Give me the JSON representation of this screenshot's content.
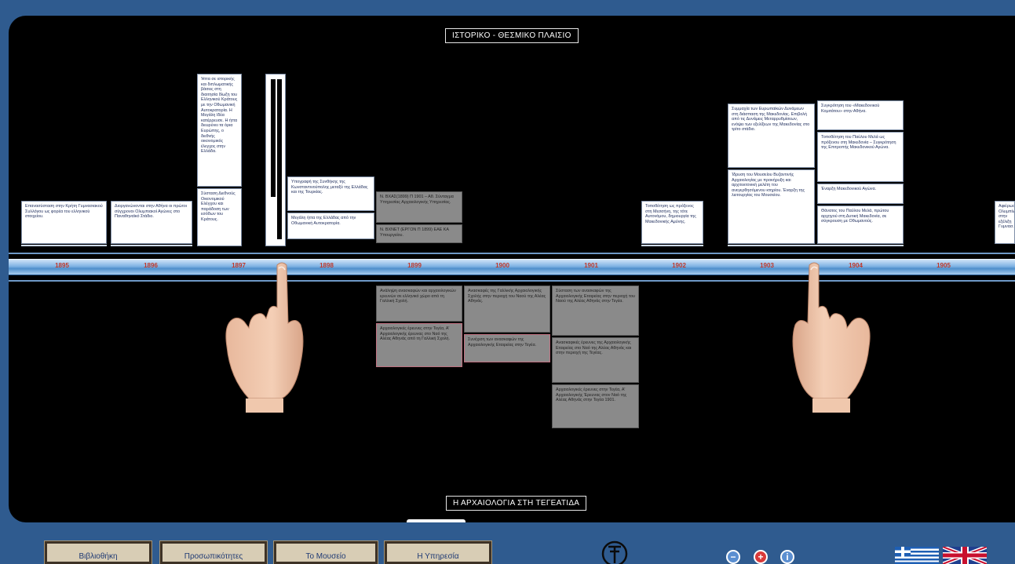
{
  "header": {
    "title": "ΙΣΤΟΡΙΚΟ - ΘΕΣΜΙΚΟ ΠΛΑΙΣΙΟ"
  },
  "subsection": {
    "title": "Η ΑΡΧΑΙΟΛΟΓΙΑ ΣΤΗ ΤΕΓΕΑΤΙΔΑ"
  },
  "timeline": {
    "years": [
      "1895",
      "1896",
      "1897",
      "1898",
      "1899",
      "1900",
      "1901",
      "1902",
      "1903",
      "1904",
      "1905"
    ]
  },
  "upper_cards": [
    {
      "text": "Επανασύσταση στην Κρήτη Γυμνασιακού Συλλόγου ως φορέα του ελληνικού στοιχείου."
    },
    {
      "text": "Διοργανώνονται στην Αθήνα οι πρώτοι σύγχρονοι Ολυμπιακοί Αγώνες στο Παναθηναϊκό Στάδιο."
    },
    {
      "text": "Ήττα σε ιστορικής και διπλωματικής βάσεις στη διαιτησία δίωξη του Ελληνικού Κράτους με την Οθωμανική Αυτοκρατορία. Η Μεγάλη Ιδέα κατέρρευσε. Η ήττα διευρύνει τα όρια Ευρώπης, ο διεθνής οικονομικός έλεγχος στην Ελλάδα."
    },
    {
      "text": "Σύσταση Διεθνούς Οικονομικού Ελέγχου και παράδοση των εσόδων του Κράτους."
    },
    {
      "text": "Υπογραφή της Συνθήκης της Κωνσταντινούπολης μεταξύ της Ελλάδας και της Τουρκίας."
    },
    {
      "text": "Μεγάλη ήττα της Ελλάδας από την Οθωμανική Αυτοκρατορία."
    },
    {
      "text": "Ν. ΒΧΑΣ(1899) Π 1901 – Αθ. Σύνταγμα Υπηρεσίας Αρχαιολογικής Υπηρεσίας."
    },
    {
      "text": "Ν. ΒΧΝΕΤ (ΕΡΓΟΝ Π 1899) ΕΑΕ ΚΑ Υπουργείου."
    },
    {
      "text": "Τοποθέτηση ως πρόξενος στη Μεσσήνη, της τότε Αυτονόμου, δημιουργία της Μακεδονικής Αμύνης."
    },
    {
      "text": "Συμμαχία των Ευρωπαϊκών Δυνάμεων στη διάσπαση της Μακεδονίας. Επιβολή από τις Δυνάμεις Μεταρρυθμίσεων, ενόψει των εξελίξεων της Μακεδονίας στο τρίτο στάδιο."
    },
    {
      "text": "Ίδρυση του Μουσείου Βυζαντινής Αρχαιολογίας με προκήρυξη και αρχιτεκτονική μελέτη του ανεγερθησόμενου κτηρίου. Έναρξη της λειτουργίας του Μουσείου."
    },
    {
      "text": "Συγκρότηση του «Μακεδονικού Κομιτάτου» στην Αθήνα."
    },
    {
      "text": "Τοποθέτηση του Παύλου Μελά ως πρόξενου στη Μακεδονία – Συγκρότηση της Επιτροπής Μακεδονικού Αγώνα."
    },
    {
      "text": "Έναρξη Μακεδονικού Αγώνα."
    },
    {
      "text": "Θάνατος του Παύλου Μελά, πρώτου αρχηγού στη Δυτική Μακεδονία, σε σύγκρουση με Οθωμανούς."
    },
    {
      "text": "Αφιέρωση Ολυμπίων στην εξέλιξη Γυμνασ."
    }
  ],
  "lower_cards": [
    {
      "text": "Ανάληψη ανασκαφών και αρχαιολογικών ερευνών σε ελληνικό χώρο από τη Γαλλική Σχολή."
    },
    {
      "text": "Αρχαιολογικές έρευνες στην Τεγέα, Α' Αρχαιολογικής έρευνας στο Ναό της Αλέας Αθηνάς από τη Γαλλική Σχολή."
    },
    {
      "text": "Ανασκαφές της Γαλλικής Αρχαιολογικής Σχολής στην περιοχή του Ναού της Αλέας Αθηνάς."
    },
    {
      "text": "Συνέχιση των ανασκαφών της Αρχαιολογικής Εταιρείας στην Τεγέα."
    },
    {
      "text": "Σύσταση των ανασκαφών της Αρχαιολογικής Εταιρείας στην περιοχή του Ναού της Αλέας Αθηνάς στην Τεγέα."
    },
    {
      "text": "Ανασκαφικές έρευνες της Αρχαιολογικής Εταιρείας στο Ναό της Αλέας Αθηνάς και στην περιοχή της Τεγέας."
    },
    {
      "text": "Αρχαιολογικές έρευνες στην Τεγέα, Α' Αρχαιολογικής Έρευνας στον Ναό της Αλέας Αθηνάς στην Τεγέα 1901."
    }
  ],
  "nav": {
    "buttons": [
      "Βιβλιοθήκη",
      "Προσωπικότητες",
      "Το Μουσείο",
      "Η Υπηρεσία"
    ]
  },
  "controls": {
    "minus_symbol": "−",
    "plus_symbol": "+",
    "info_symbol": "i"
  },
  "icons": {
    "logo": "museum-logo-icon",
    "flag_gr": "greek-flag-icon",
    "flag_en": "uk-flag-icon",
    "hand_left": "pointing-hand-icon",
    "hand_right": "pointing-hand-icon"
  },
  "colors": {
    "background": "#2f5b8f",
    "timeline_bar": "#7fb3e4",
    "year_text": "#c0392b",
    "minus_button": "#5b8fd1",
    "plus_button": "#d93a3a",
    "info_button": "#5b8fd1"
  }
}
